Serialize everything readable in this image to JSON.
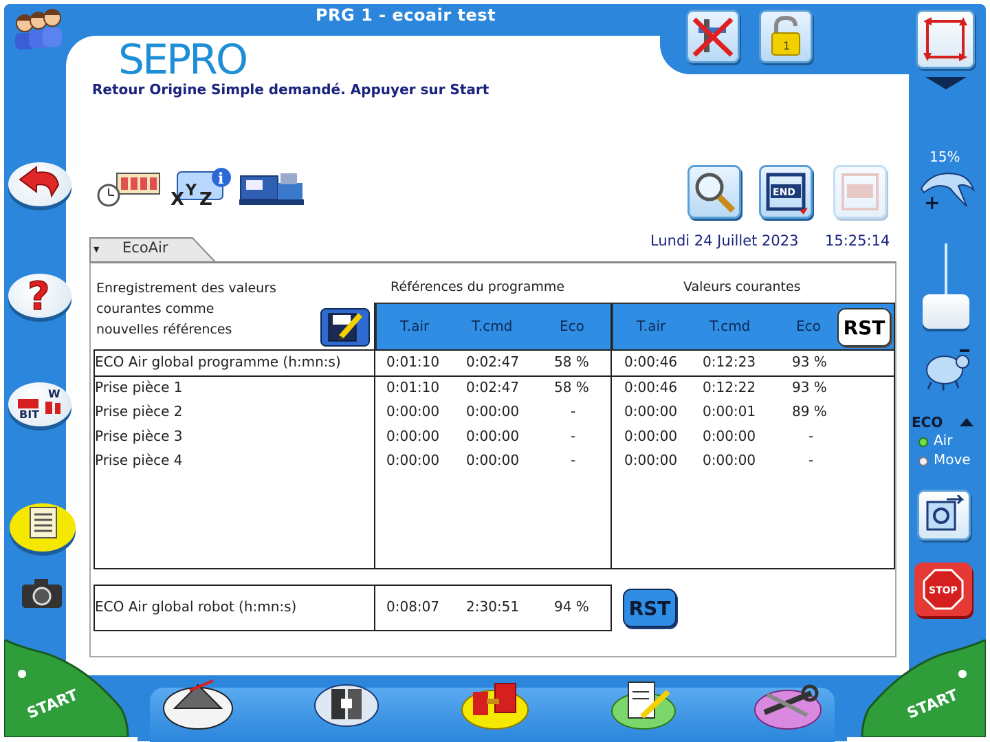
{
  "window": {
    "title": "PRG 1 - ecoair test",
    "logo_text": "SEPRO",
    "status_message": "Retour Origine Simple demandé. Appuyer sur Start"
  },
  "datetime": {
    "date": "Lundi 24 Juillet 2023",
    "time": "15:25:14"
  },
  "tab": {
    "label": "EcoAir"
  },
  "section": {
    "save_text_line1": "Enregistrement des valeurs",
    "save_text_line2": "courantes comme",
    "save_text_line3": "nouvelles références",
    "references_title": "Références du programme",
    "current_title": "Valeurs courantes"
  },
  "columns": {
    "references": [
      "T.air",
      "T.cmd",
      "Eco"
    ],
    "current": [
      "T.air",
      "T.cmd",
      "Eco"
    ]
  },
  "rows": [
    {
      "label": "ECO Air global programme (h:mn:s)",
      "ref": [
        "0:01:10",
        "0:02:47",
        "58 %"
      ],
      "cur": [
        "0:00:46",
        "0:12:23",
        "93 %"
      ]
    },
    {
      "label": "Prise pièce 1",
      "ref": [
        "0:01:10",
        "0:02:47",
        "58 %"
      ],
      "cur": [
        "0:00:46",
        "0:12:22",
        "93 %"
      ]
    },
    {
      "label": "Prise pièce 2",
      "ref": [
        "0:00:00",
        "0:00:00",
        "-"
      ],
      "cur": [
        "0:00:00",
        "0:00:01",
        "89 %"
      ]
    },
    {
      "label": "Prise pièce 3",
      "ref": [
        "0:00:00",
        "0:00:00",
        "-"
      ],
      "cur": [
        "0:00:00",
        "0:00:00",
        "-"
      ]
    },
    {
      "label": "Prise pièce 4",
      "ref": [
        "0:00:00",
        "0:00:00",
        "-"
      ],
      "cur": [
        "0:00:00",
        "0:00:00",
        "-"
      ]
    }
  ],
  "robot_row": {
    "label": "ECO Air global robot (h:mn:s)",
    "values": [
      "0:08:07",
      "2:30:51",
      "94 %"
    ]
  },
  "buttons": {
    "rst_label": "RST",
    "rst_robot_label": "RST",
    "start_left": "START",
    "start_right": "START",
    "end_label": "END",
    "bit_label": "BIT",
    "stop_label": "STOP"
  },
  "sidebar": {
    "speed": "15%",
    "eco_label": "ECO",
    "eco_options": [
      "Air",
      "Move"
    ]
  },
  "colors": {
    "frame_blue": "#2b86dc",
    "header_blue": "#2f8de4",
    "text_navy": "#1a237e",
    "stop_red": "#e53935",
    "start_green": "#2e9d3a"
  },
  "icons": {
    "top": [
      "users-icon",
      "tool-crossed-icon",
      "padlock-icon",
      "frame-arrows-icon"
    ],
    "toolbar": [
      "cycle-timer-icon",
      "xyz-info-icon",
      "machine-icon",
      "magnifier-icon",
      "end-icon",
      "disabled-icon"
    ],
    "left": [
      "back-arrow-icon",
      "help-icon",
      "bit-io-icon",
      "document-icon",
      "camera-icon"
    ],
    "bottom": [
      "production-icon",
      "mold-icon",
      "tools-icon",
      "edit-icon",
      "settings-icon"
    ]
  }
}
